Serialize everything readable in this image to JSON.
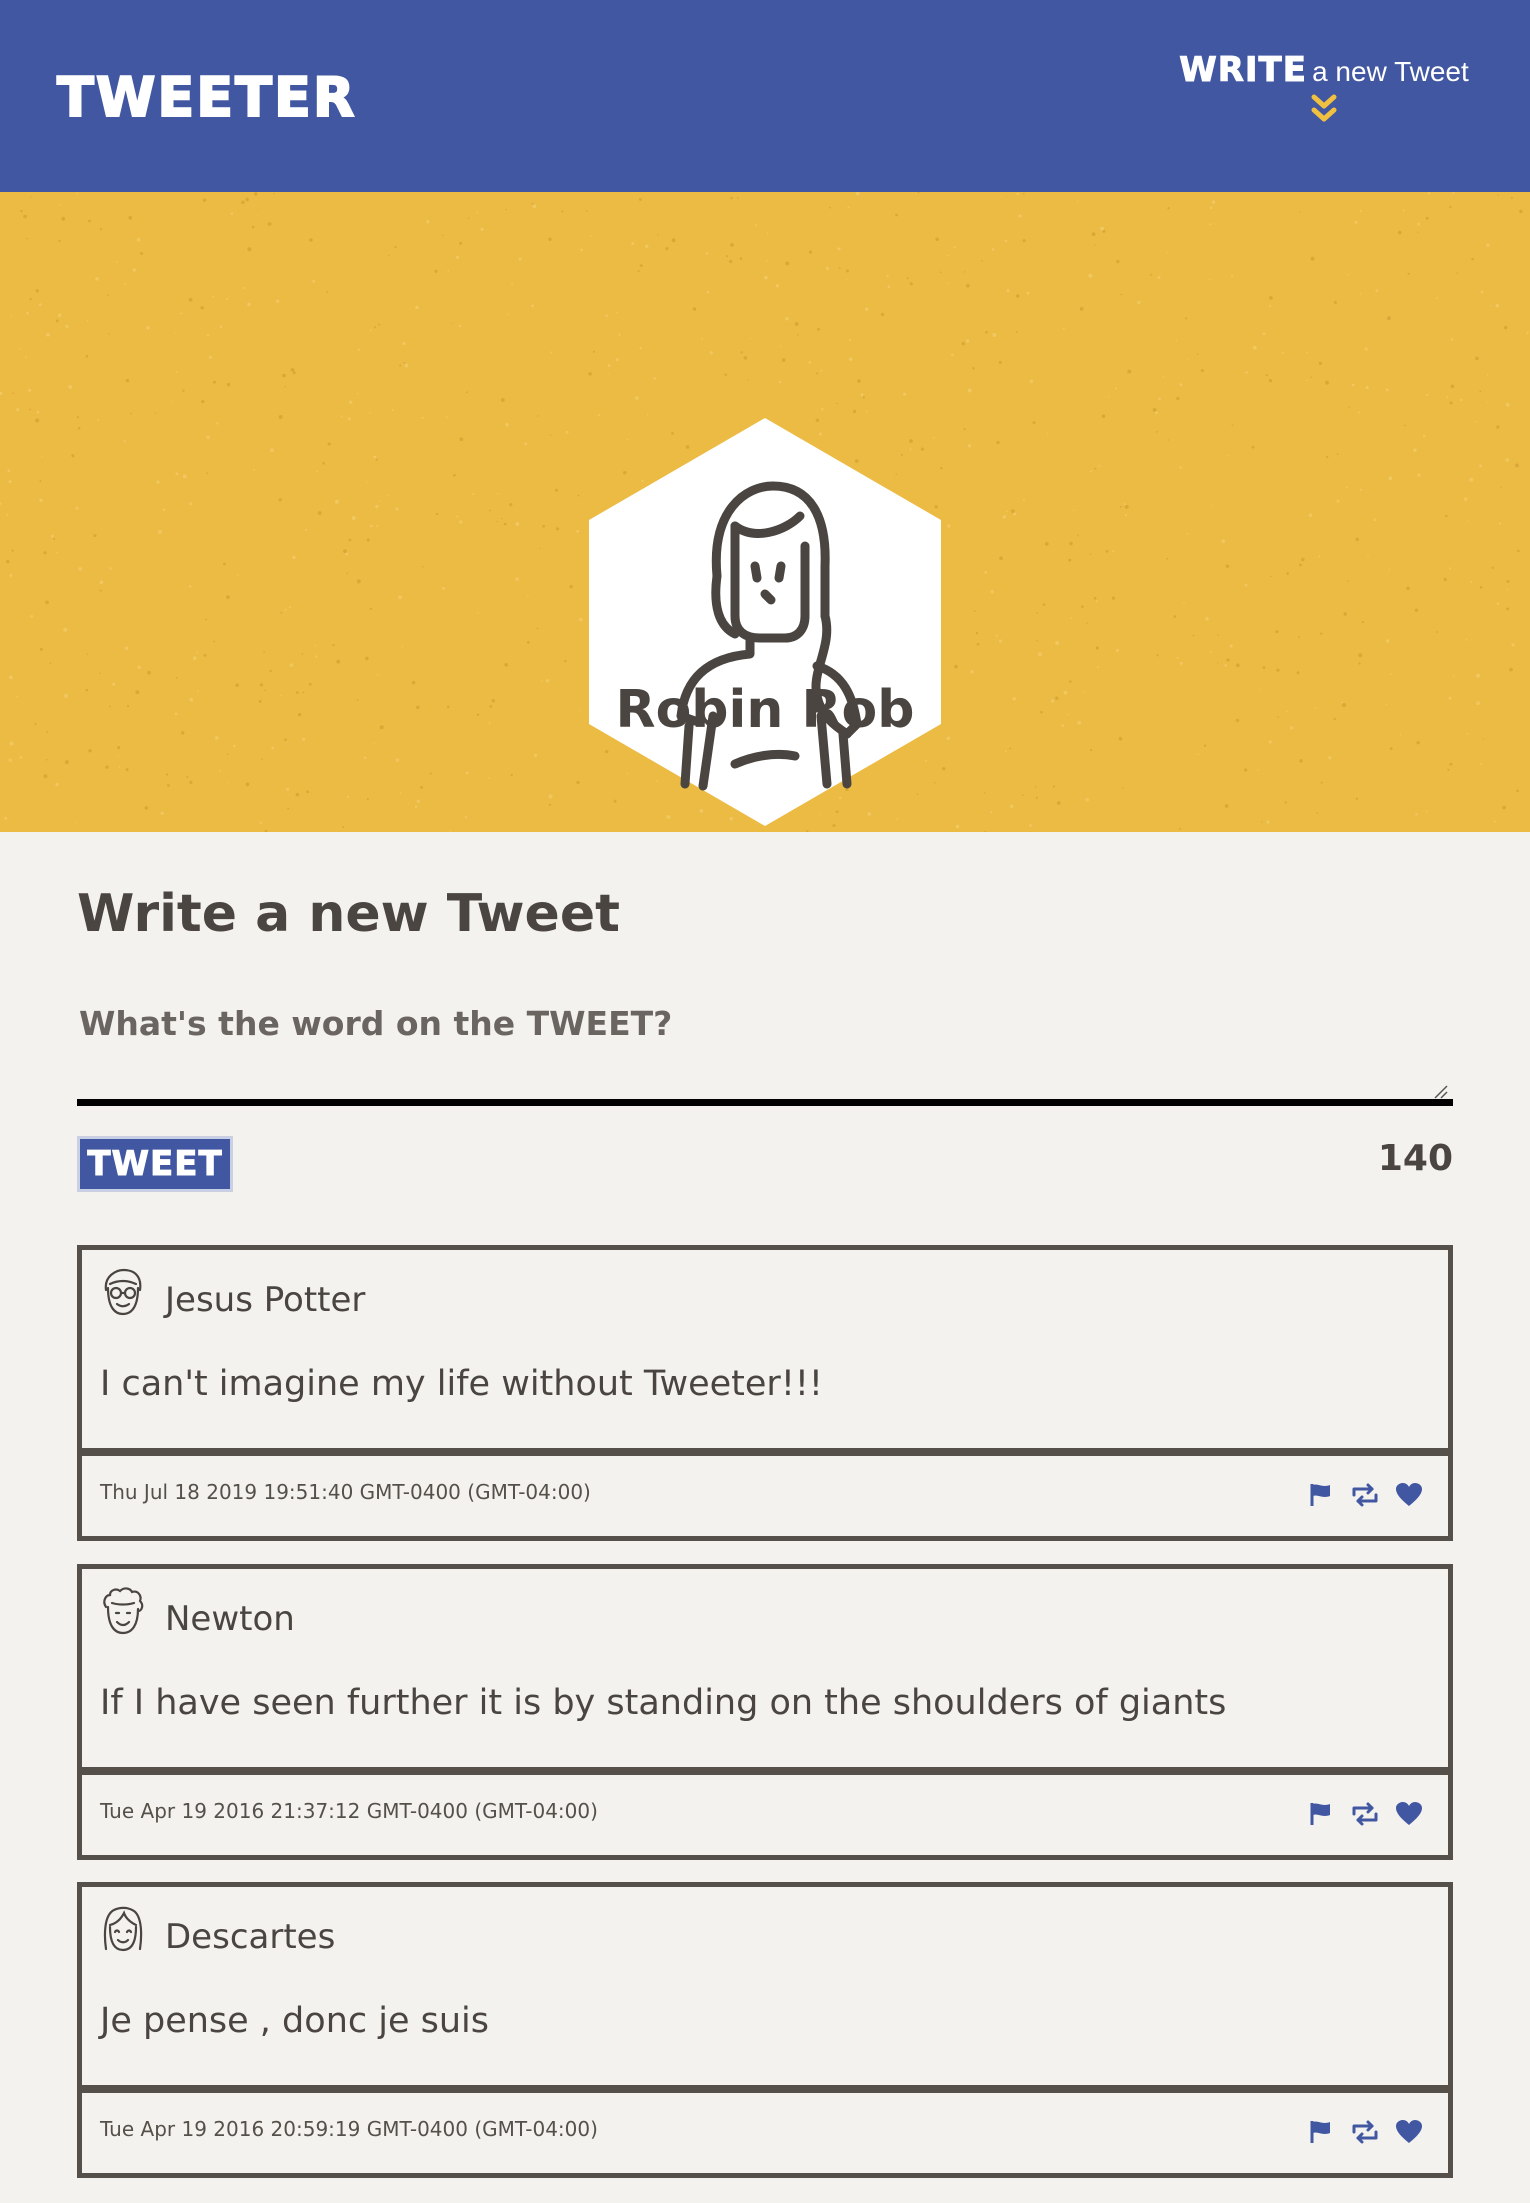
{
  "nav": {
    "brand": "TWEETER",
    "compose_strong": "WRITE",
    "compose_rest": "a new Tweet",
    "accent_color": "#4157a1",
    "chevron_color": "#f0c040"
  },
  "profile": {
    "name": "Robin Rob",
    "header_color": "#ecbb44"
  },
  "compose": {
    "title": "Write a new Tweet",
    "placeholder": "What's the word on the TWEET?",
    "button_label": "TWEET",
    "counter": "140"
  },
  "tweets": [
    {
      "author": "Jesus Potter",
      "icon": "glasses-face-icon",
      "text": "I can't imagine my life without Tweeter!!!",
      "date": "Thu Jul 18 2019 19:51:40 GMT-0400 (GMT-04:00)"
    },
    {
      "author": "Newton",
      "icon": "curly-hair-face-icon",
      "text": "If I have seen further it is by standing on the shoulders of giants",
      "date": "Tue Apr 19 2016 21:37:12 GMT-0400 (GMT-04:00)"
    },
    {
      "author": "Descartes",
      "icon": "long-hair-face-icon",
      "text": "Je pense , donc je suis",
      "date": "Tue Apr 19 2016 20:59:19 GMT-0400 (GMT-04:00)"
    }
  ],
  "actions": [
    "flag-icon",
    "retweet-icon",
    "heart-icon"
  ]
}
